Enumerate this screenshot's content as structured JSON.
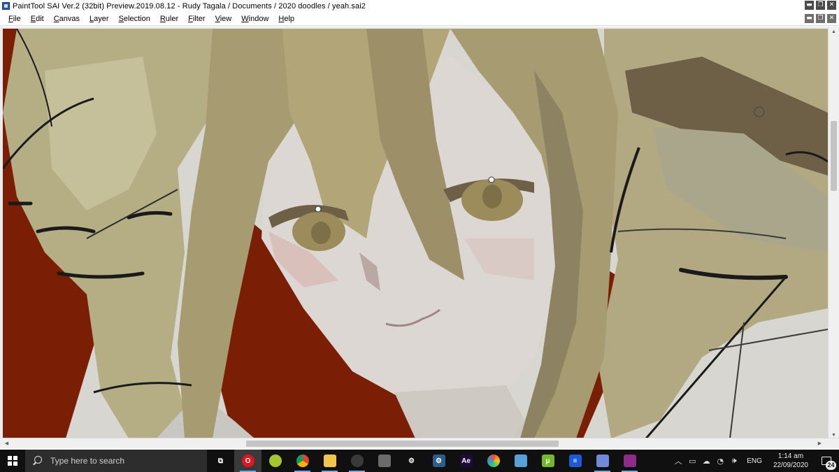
{
  "window": {
    "title": "PaintTool SAI Ver.2 (32bit) Preview.2019.08.12 - Rudy Tagala / Documents / 2020 doodles / yeah.sai2",
    "app_icon": "painttool-sai-icon",
    "buttons": {
      "minimize": "▬",
      "restore": "❐",
      "close": "✕"
    }
  },
  "menu": {
    "items": [
      {
        "accel": "F",
        "rest": "ile"
      },
      {
        "accel": "E",
        "rest": "dit"
      },
      {
        "accel": "C",
        "rest": "anvas"
      },
      {
        "accel": "L",
        "rest": "ayer"
      },
      {
        "accel": "S",
        "rest": "election"
      },
      {
        "accel": "R",
        "rest": "uler"
      },
      {
        "accel": "F",
        "rest": "ilter"
      },
      {
        "accel": "V",
        "rest": "iew"
      },
      {
        "accel": "W",
        "rest": "indow"
      },
      {
        "accel": "H",
        "rest": "elp"
      }
    ],
    "doc_buttons": {
      "minimize": "▬",
      "restore": "❐",
      "close": "✕"
    }
  },
  "canvas": {
    "content": "digital painting",
    "colors": {
      "background": "#d8d6d0",
      "red": "#7a1f06",
      "hair_light": "#b5ad84",
      "hair_dark": "#6d6047",
      "skin": "#dcd7d3",
      "iris": "#9c8c5c",
      "lineart": "#1a1a1a"
    }
  },
  "scrollbars": {
    "arrow_up": "▲",
    "arrow_down": "▼",
    "arrow_left": "◀",
    "arrow_right": "▶"
  },
  "taskbar": {
    "search_placeholder": "Type here to search",
    "apps": [
      {
        "name": "task-view-icon",
        "label": "⧉",
        "color": "#101010",
        "running": false,
        "active": false
      },
      {
        "name": "opera-icon",
        "label": "O",
        "color": "#e0161e",
        "running": true,
        "active": true
      },
      {
        "name": "tennis-ball-icon",
        "label": "",
        "color": "#a5c631",
        "running": false,
        "active": false
      },
      {
        "name": "chrome-icon",
        "label": "",
        "color": "#dd4b39",
        "running": true,
        "active": false
      },
      {
        "name": "file-explorer-icon",
        "label": "",
        "color": "#f2c44e",
        "running": true,
        "active": false
      },
      {
        "name": "obs-icon",
        "label": "",
        "color": "#3a3a3a",
        "running": true,
        "active": false
      },
      {
        "name": "pen-tablet-icon",
        "label": "",
        "color": "#6b6b6b",
        "running": false,
        "active": false
      },
      {
        "name": "gear-icon",
        "label": "⚙",
        "color": "#101010",
        "running": false,
        "active": false
      },
      {
        "name": "settings-cogs-icon",
        "label": "⚙",
        "color": "#2f5d8a",
        "running": false,
        "active": false
      },
      {
        "name": "after-effects-icon",
        "label": "Ae",
        "color": "#1f0a3d",
        "running": false,
        "active": false
      },
      {
        "name": "colors-app-icon",
        "label": "",
        "color": "#f5f5f5",
        "running": false,
        "active": false
      },
      {
        "name": "blue-notes-icon",
        "label": "",
        "color": "#5aa0d8",
        "running": false,
        "active": false
      },
      {
        "name": "utorrent-icon",
        "label": "μ",
        "color": "#76b82a",
        "running": false,
        "active": false
      },
      {
        "name": "bar-app-icon",
        "label": "≡",
        "color": "#1e5ad8",
        "running": false,
        "active": false
      },
      {
        "name": "discord-icon",
        "label": "",
        "color": "#7289da",
        "running": true,
        "active": false
      },
      {
        "name": "winrar-icon",
        "label": "",
        "color": "#8b2c8b",
        "running": true,
        "active": false
      }
    ],
    "tray": {
      "chevron": "︿",
      "battery": "▭",
      "cloud": "☁",
      "wifi": "◔",
      "volume": "🕪",
      "language": "ENG",
      "time": "1:14 am",
      "date": "22/09/2020",
      "notification_count": "24"
    }
  }
}
